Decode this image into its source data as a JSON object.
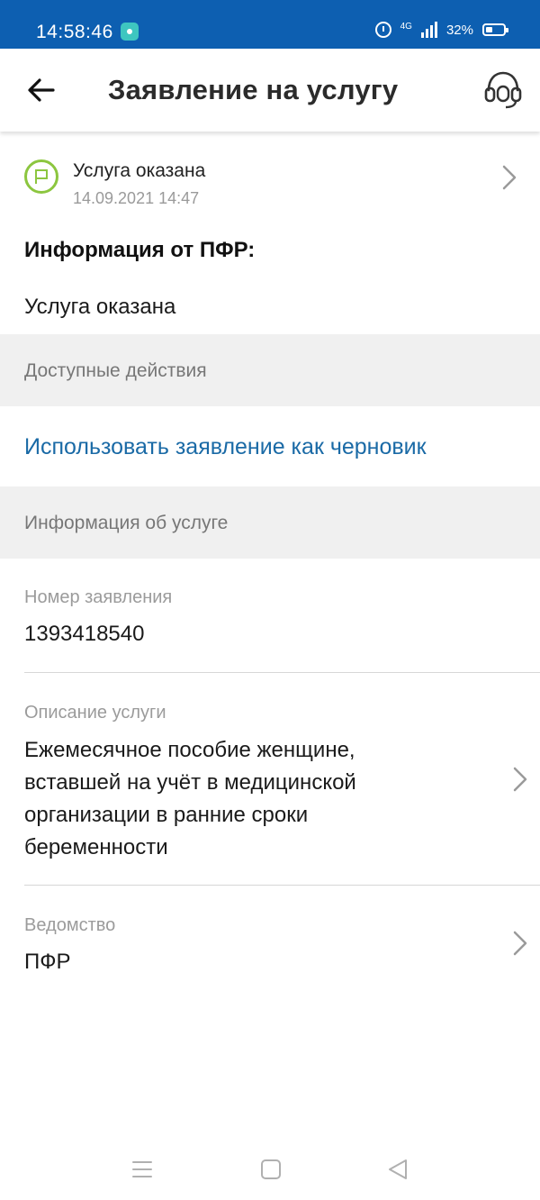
{
  "status_bar": {
    "time": "14:58:46",
    "network": "4G",
    "battery": "32%"
  },
  "header": {
    "title": "Заявление на услугу",
    "back_icon": "arrow-left-icon",
    "support_icon": "headset-icon"
  },
  "status": {
    "title": "Услуга оказана",
    "date": "14.09.2021 14:47",
    "icon": "flag-icon",
    "accent": "#8cc63f"
  },
  "pfr_info": {
    "label": "Информация от ПФР:",
    "value": "Услуга оказана"
  },
  "sections": {
    "actions": "Доступные действия",
    "service_info": "Информация об услуге"
  },
  "actions": {
    "use_as_draft": "Использовать заявление как черновик",
    "link_color": "#1a6aa6"
  },
  "fields": {
    "number_label": "Номер заявления",
    "number_value": "1393418540",
    "description_label": "Описание услуги",
    "description_lines": [
      "Ежемесячное пособие женщине,",
      "вставшей на учёт в медицинской",
      "организации в ранние сроки",
      "беременности"
    ],
    "department_label": "Ведомство",
    "department_value": "ПФР"
  },
  "colors": {
    "status_bar": "#0d5fb1",
    "section_bg": "#f0f0f0"
  },
  "navbar": {
    "menu_icon": "menu-icon",
    "home_icon": "square-home-icon",
    "back_icon": "triangle-back-icon"
  }
}
